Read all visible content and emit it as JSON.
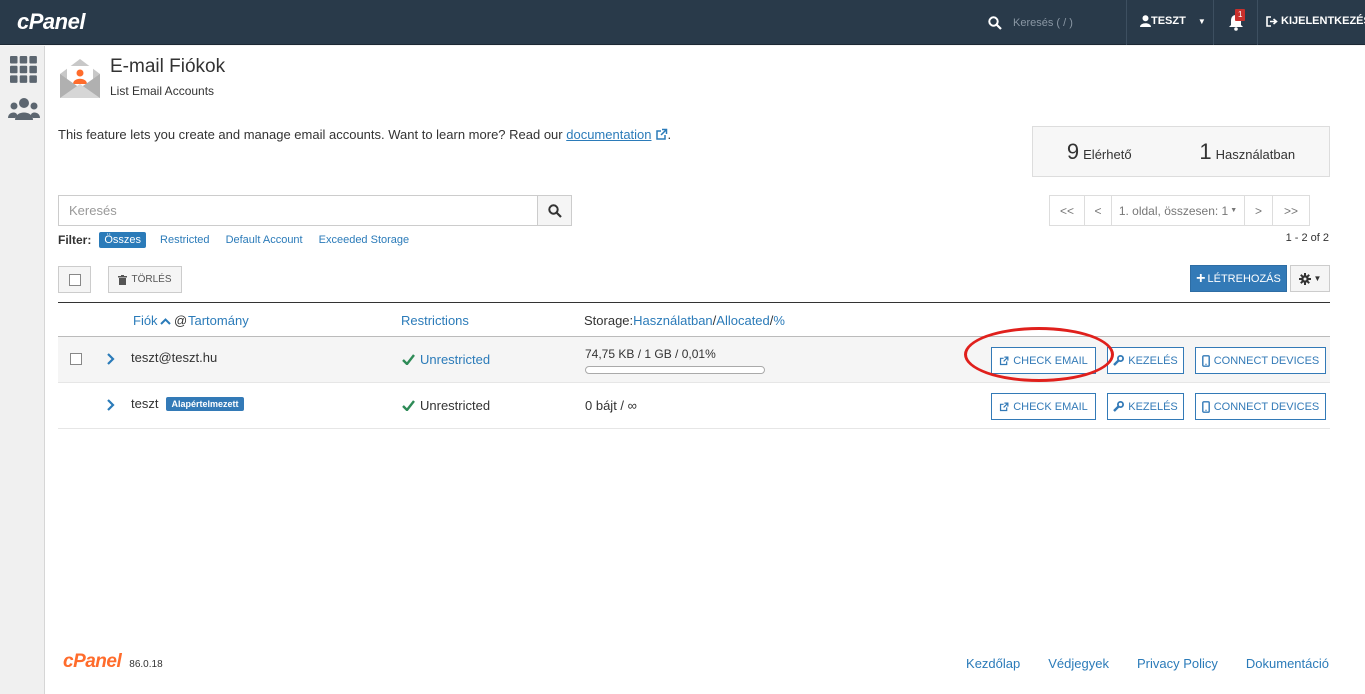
{
  "topbar": {
    "logo": "cPanel",
    "search_placeholder": "Keresés ( / )",
    "user": "TESZT",
    "notification_count": "1",
    "logout": "KIJELENTKEZÉS"
  },
  "page": {
    "title": "E-mail Fiókok",
    "subtitle": "List Email Accounts",
    "intro_text": "This feature lets you create and manage email accounts. Want to learn more? Read our ",
    "intro_link": "documentation",
    "intro_end": "."
  },
  "stats": {
    "available_count": "9",
    "available_label": "Elérhető",
    "used_count": "1",
    "used_label": "Használatban"
  },
  "search": {
    "placeholder": "Keresés"
  },
  "pager": {
    "first": "<<",
    "prev": "<",
    "current": "1. oldal, összesen: 1",
    "next": ">",
    "last": ">>",
    "range": "1 - 2 of 2"
  },
  "filters": {
    "label": "Filter:",
    "items": [
      "Összes",
      "Restricted",
      "Default Account",
      "Exceeded Storage"
    ],
    "active_index": 0
  },
  "toolbar": {
    "delete_label": "TÖRLÉS",
    "create_label": "LÉTREHOZÁS"
  },
  "table": {
    "header": {
      "account": "Fiók",
      "at": "@",
      "domain": "Tartomány",
      "restrictions": "Restrictions",
      "storage_prefix": "Storage:",
      "storage_used": "Használatban",
      "sep1": "/",
      "storage_allocated": "Allocated",
      "sep2": "/",
      "storage_percent": "%"
    },
    "rows": [
      {
        "account": "teszt@teszt.hu",
        "badge": "",
        "restriction": "Unrestricted",
        "storage": "74,75 KB / 1 GB / 0,01%",
        "usage_fraction": 0.0001,
        "check_email": "CHECK EMAIL",
        "manage": "KEZELÉS",
        "connect": "CONNECT DEVICES"
      },
      {
        "account": "teszt",
        "badge": "Alapértelmezett",
        "restriction": "Unrestricted",
        "storage": "0 bájt / ∞",
        "check_email": "CHECK EMAIL",
        "manage": "KEZELÉS",
        "connect": "CONNECT DEVICES"
      }
    ]
  },
  "footer": {
    "logo": "cPanel",
    "version": "86.0.18",
    "links": [
      "Kezdőlap",
      "Védjegyek",
      "Privacy Policy",
      "Dokumentáció"
    ]
  },
  "colors": {
    "topbar": "#293a4a",
    "accent": "#337ab7",
    "brand_orange": "#ff6c2c",
    "highlight": "#e0201c",
    "check": "#2e8b57"
  }
}
